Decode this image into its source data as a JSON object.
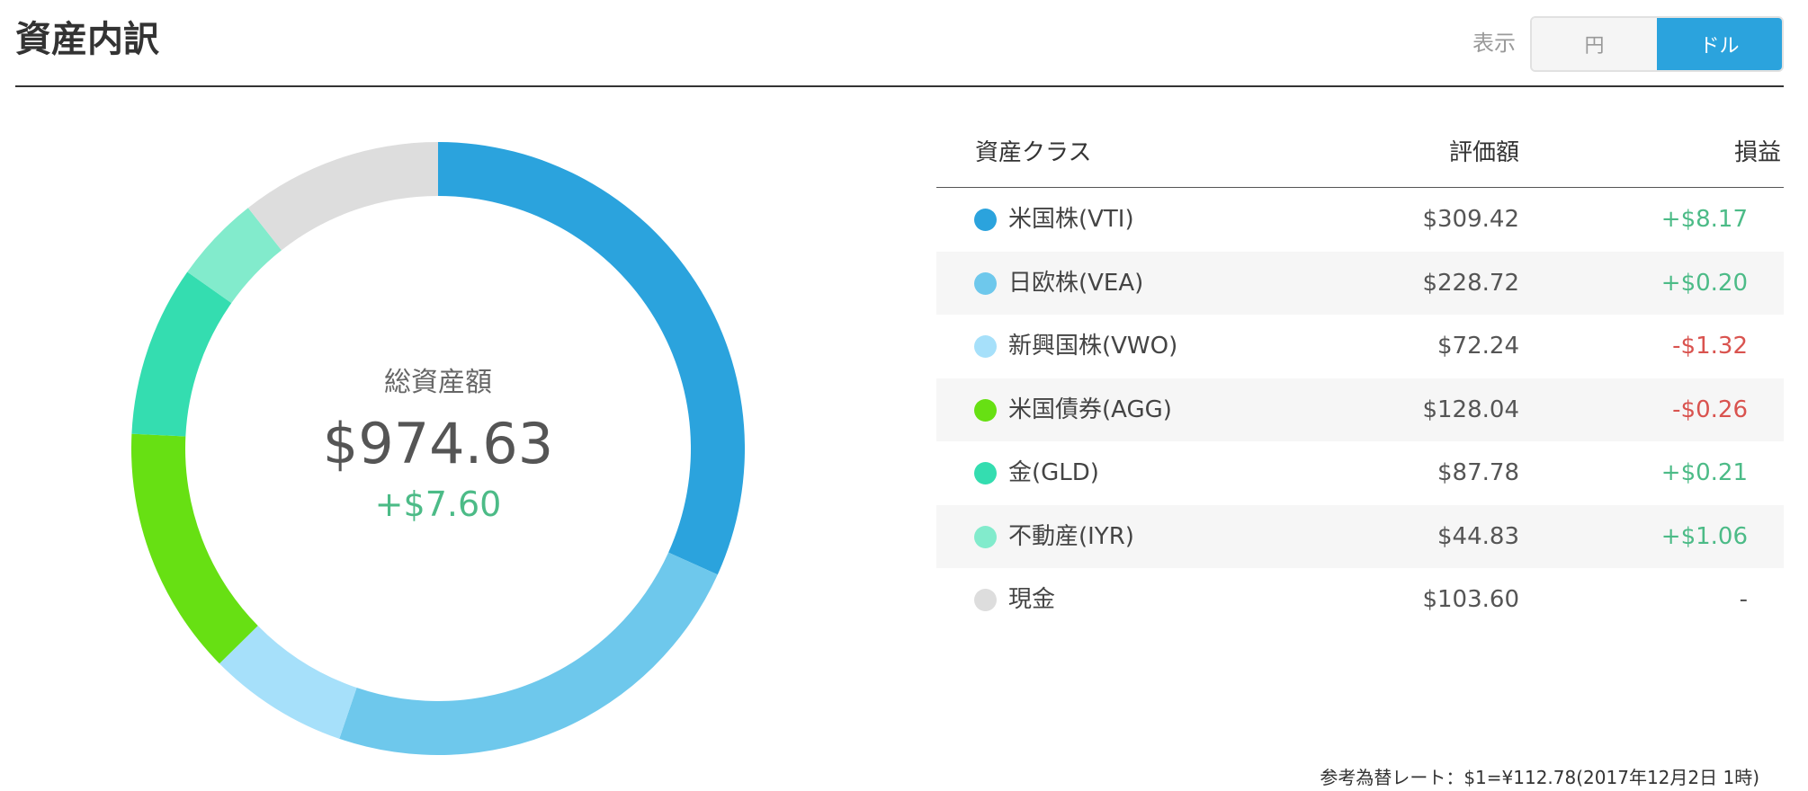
{
  "header": {
    "title": "資産内訳",
    "display_label": "表示",
    "currency_toggle": {
      "options": [
        "円",
        "ドル"
      ],
      "selected": "ドル"
    }
  },
  "summary": {
    "label": "総資産額",
    "total": "$974.63",
    "change": "+$7.60"
  },
  "table": {
    "headers": {
      "asset_class": "資産クラス",
      "value": "評価額",
      "pnl": "損益"
    },
    "rows": [
      {
        "name": "米国株(VTI)",
        "value": "$309.42",
        "pnl": "+$8.17",
        "pnl_sign": "pos",
        "color": "#2ba3dd"
      },
      {
        "name": "日欧株(VEA)",
        "value": "$228.72",
        "pnl": "+$0.20",
        "pnl_sign": "pos",
        "color": "#6ec8ec"
      },
      {
        "name": "新興国株(VWO)",
        "value": "$72.24",
        "pnl": "-$1.32",
        "pnl_sign": "neg",
        "color": "#a6e0fa"
      },
      {
        "name": "米国債券(AGG)",
        "value": "$128.04",
        "pnl": "-$0.26",
        "pnl_sign": "neg",
        "color": "#67e013"
      },
      {
        "name": "金(GLD)",
        "value": "$87.78",
        "pnl": "+$0.21",
        "pnl_sign": "pos",
        "color": "#34ddb0"
      },
      {
        "name": "不動産(IYR)",
        "value": "$44.83",
        "pnl": "+$1.06",
        "pnl_sign": "pos",
        "color": "#82ebcc"
      },
      {
        "name": "現金",
        "value": "$103.60",
        "pnl": "-",
        "pnl_sign": "none",
        "color": "#dddddd"
      }
    ]
  },
  "rate_note": "参考為替レート：$1=¥112.78(2017年12月2日 1時)",
  "chart_data": {
    "type": "pie",
    "variant": "donut",
    "center_label": "総資産額",
    "center_value": "$974.63",
    "center_change": "+$7.60",
    "categories": [
      "米国株(VTI)",
      "日欧株(VEA)",
      "新興国株(VWO)",
      "米国債券(AGG)",
      "金(GLD)",
      "不動産(IYR)",
      "現金"
    ],
    "values": [
      309.42,
      228.72,
      72.24,
      128.04,
      87.78,
      44.83,
      103.6
    ],
    "colors": [
      "#2ba3dd",
      "#6ec8ec",
      "#a6e0fa",
      "#67e013",
      "#34ddb0",
      "#82ebcc",
      "#dddddd"
    ],
    "start": "top",
    "direction": "clockwise",
    "legend": "right-table"
  }
}
